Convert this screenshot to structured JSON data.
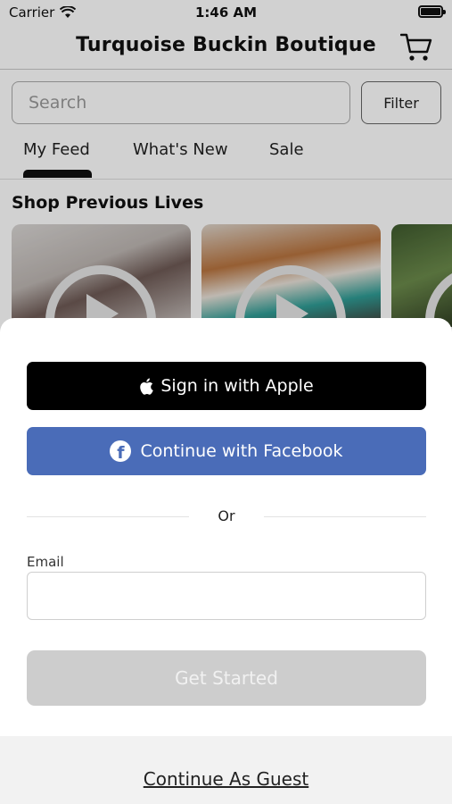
{
  "status_bar": {
    "carrier": "Carrier",
    "time": "1:46 AM"
  },
  "nav": {
    "title": "Turquoise Buckin Boutique",
    "cart_icon": "cart-icon"
  },
  "search": {
    "placeholder": "Search",
    "value": "",
    "filter_label": "Filter"
  },
  "tabs": [
    {
      "label": "My Feed",
      "active": true
    },
    {
      "label": "What's New",
      "active": false
    },
    {
      "label": "Sale",
      "active": false
    }
  ],
  "section": {
    "title": "Shop Previous Lives"
  },
  "sheet": {
    "apple_label": "Sign in with Apple",
    "facebook_label": "Continue with Facebook",
    "divider_text": "Or",
    "email_label": "Email",
    "email_value": "",
    "get_started_label": "Get Started",
    "guest_label": "Continue As Guest"
  },
  "colors": {
    "apple_bg": "#000000",
    "facebook_bg": "#4a6cb8",
    "get_started_disabled_bg": "#cdcdcd",
    "guest_area_bg": "#f2f2f2"
  }
}
